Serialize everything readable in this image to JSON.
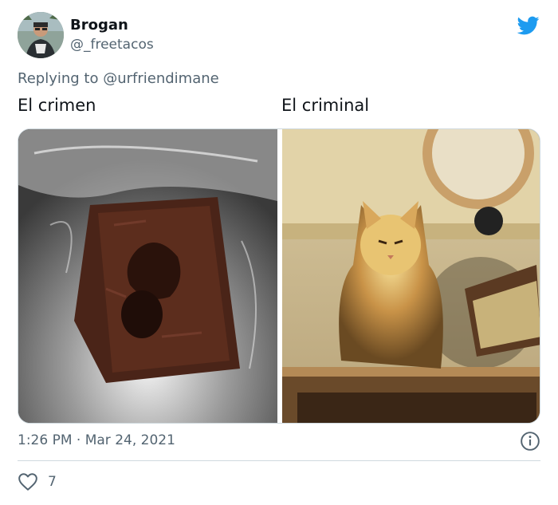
{
  "author": {
    "display_name": "Brogan",
    "handle": "@_freetacos",
    "avatar_icon": "avatar-photo"
  },
  "brand_icon": "twitter-bird-icon",
  "reply": {
    "prefix": "Replying to",
    "mention": "@urfriendimane"
  },
  "body": {
    "left_caption": "El crimen",
    "right_caption": "El criminal"
  },
  "media": {
    "left_image": "brownie-with-missing-bite",
    "right_image": "orange-cat-under-lamp"
  },
  "meta": {
    "timestamp": "1:26 PM · Mar 24, 2021",
    "info_icon": "info-icon"
  },
  "engagement": {
    "like_icon": "heart-outline-icon",
    "like_count": "7"
  },
  "colors": {
    "twitter_blue": "#1d9bf0",
    "secondary_text": "#536471",
    "primary_text": "#0f1419",
    "border": "#cfd9de"
  }
}
